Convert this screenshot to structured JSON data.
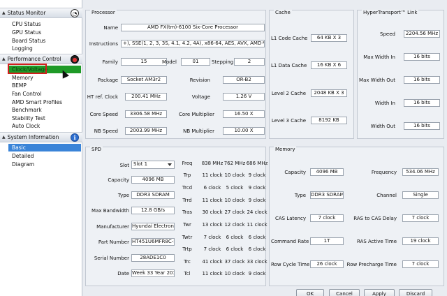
{
  "sidebar": {
    "status_monitor": {
      "header": "Status Monitor",
      "items": [
        "CPU Status",
        "GPU Status",
        "Board Status",
        "Logging"
      ]
    },
    "performance_control": {
      "header": "Performance Control",
      "items": [
        "Clock/Voltage",
        "Memory",
        "BEMP",
        "Fan Control",
        "AMD Smart Profiles",
        "Benchmark",
        "Stability Test",
        "Auto Clock"
      ]
    },
    "system_information": {
      "header": "System Information",
      "items": [
        "Basic",
        "Detailed",
        "Diagram"
      ]
    }
  },
  "processor": {
    "title": "Processor",
    "name_label": "Name",
    "name": "AMD FX(tm)-6100 Six-Core Processor",
    "instructions_label": "Instructions",
    "instructions": "+), SSE(1, 2, 3, 3S, 4.1, 4.2, 4A), x86-64, AES, AVX, AMD-V, XOP",
    "family_label": "Family",
    "family": "15",
    "model_label": "Model",
    "model": "01",
    "stepping_label": "Stepping",
    "stepping": "2",
    "package_label": "Package",
    "package": "Socket AM3r2",
    "revision_label": "Revision",
    "revision": "OR-B2",
    "ht_clock_label": "HT ref. Clock",
    "ht_clock": "200.41 MHz",
    "voltage_label": "Voltage",
    "voltage": "1.26 V",
    "core_speed_label": "Core Speed",
    "core_speed": "3306.58 MHz",
    "core_mult_label": "Core Multiplier",
    "core_mult": "16.50 X",
    "nb_speed_label": "NB Speed",
    "nb_speed": "2003.99 MHz",
    "nb_mult_label": "NB Multiplier",
    "nb_mult": "10.00 X"
  },
  "cache": {
    "title": "Cache",
    "l1_code_label": "L1 Code Cache",
    "l1_code": "64 KB X 3",
    "l1_data_label": "L1 Data Cache",
    "l1_data": "16 KB X 6",
    "l2_label": "Level 2 Cache",
    "l2": "2048 KB X 3",
    "l3_label": "Level 3 Cache",
    "l3": "8192 KB"
  },
  "ht_link": {
    "title": "HyperTransport™ Link",
    "speed_label": "Speed",
    "speed": "2204.56 MHz",
    "max_width_in_label": "Max Width In",
    "max_width_in": "16 bits",
    "max_width_out_label": "Max Width Out",
    "max_width_out": "16 bits",
    "width_in_label": "Width In",
    "width_in": "16 bits",
    "width_out_label": "Width Out",
    "width_out": "16 bits"
  },
  "spd": {
    "title": "SPD",
    "slot_label": "Slot",
    "slot": "Slot 1",
    "capacity_label": "Capacity",
    "capacity": "4096 MB",
    "type_label": "Type",
    "type": "DDR3 SDRAM",
    "max_bw_label": "Max Bandwidth",
    "max_bw": "12.8 GB/s",
    "manufacturer_label": "Manufacturer",
    "manufacturer": "Hyundai Electronics",
    "part_label": "Part Number",
    "part": "HT451U6MFR8C-PB",
    "serial_label": "Serial Number",
    "serial": "28ADE1C0",
    "date_label": "Date",
    "date": "Week 33 Year 2012",
    "timing_header": [
      "Freq",
      "838 MHz",
      "762 MHz",
      "686 MHz"
    ],
    "timings": [
      [
        "Trp",
        "11 clock",
        "10 clock",
        "9 clock"
      ],
      [
        "Trcd",
        "6 clock",
        "5 clock",
        "9 clock"
      ],
      [
        "Trrd",
        "11 clock",
        "10 clock",
        "9 clock"
      ],
      [
        "Tras",
        "30 clock",
        "27 clock",
        "24 clock"
      ],
      [
        "Twr",
        "13 clock",
        "12 clock",
        "11 clock"
      ],
      [
        "Twtr",
        "7 clock",
        "6 clock",
        "6 clock"
      ],
      [
        "Trtp",
        "7 clock",
        "6 clock",
        "6 clock"
      ],
      [
        "Trc",
        "41 clock",
        "37 clock",
        "33 clock"
      ],
      [
        "Tcl",
        "11 clock",
        "10 clock",
        "9 clock"
      ]
    ]
  },
  "memory": {
    "title": "Memory",
    "capacity_label": "Capacity",
    "capacity": "4096 MB",
    "frequency_label": "Frequency",
    "frequency": "534.06 MHz",
    "type_label": "Type",
    "type": "DDR3 SDRAM",
    "channel_label": "Channel",
    "channel": "Single",
    "cas_label": "CAS Latency",
    "cas": "7 clock",
    "ras_cas_label": "RAS to CAS Delay",
    "ras_cas": "7 clock",
    "cmd_rate_label": "Command Rate",
    "cmd_rate": "1T",
    "ras_active_label": "RAS Active Time",
    "ras_active": "19 clock",
    "row_cycle_label": "Row Cycle Time",
    "row_cycle": "26 clock",
    "row_precharge_label": "Row Precharge Time",
    "row_precharge": "7 clock"
  },
  "buttons": {
    "ok": "OK",
    "cancel": "Cancel",
    "apply": "Apply",
    "discard": "Discard"
  },
  "colors": {
    "selected_green": "#1e9a27",
    "selected_blue": "#3a84d8",
    "highlight_red": "#d21e1e"
  }
}
